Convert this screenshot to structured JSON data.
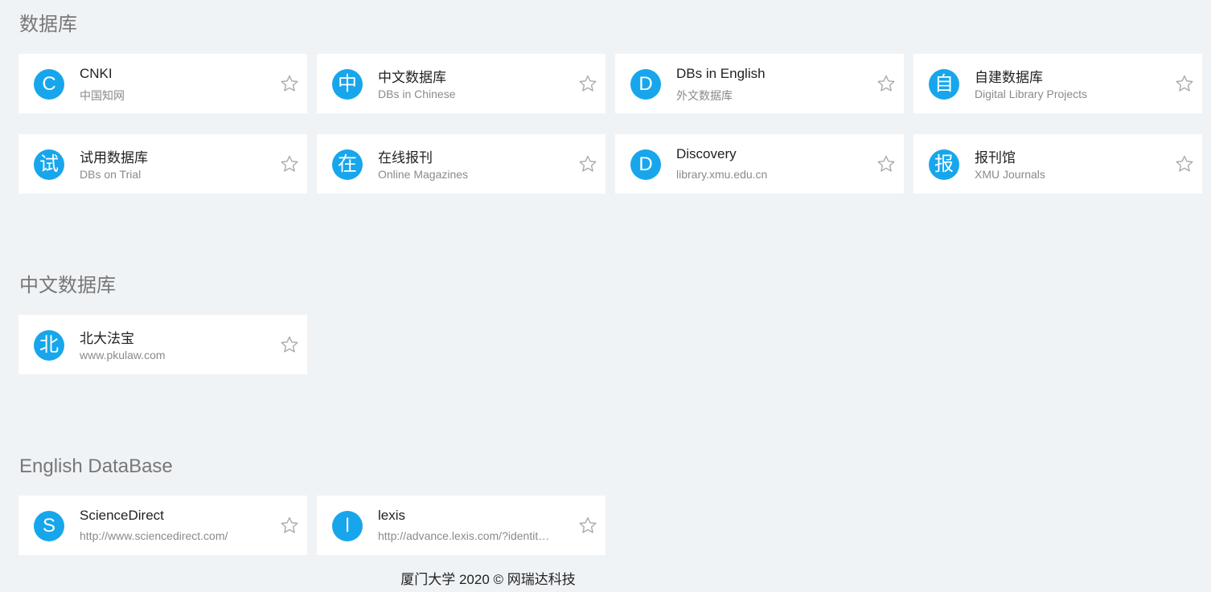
{
  "sections": [
    {
      "title": "数据库",
      "cards": [
        {
          "badge": "C",
          "title": "CNKI",
          "subtitle": "中国知网"
        },
        {
          "badge": "中",
          "title": "中文数据库",
          "subtitle": "DBs in Chinese"
        },
        {
          "badge": "D",
          "title": "DBs in English",
          "subtitle": "外文数据库"
        },
        {
          "badge": "自",
          "title": "自建数据库",
          "subtitle": "Digital Library Projects"
        },
        {
          "badge": "试",
          "title": "试用数据库",
          "subtitle": "DBs on Trial"
        },
        {
          "badge": "在",
          "title": "在线报刊",
          "subtitle": "Online Magazines"
        },
        {
          "badge": "D",
          "title": "Discovery",
          "subtitle": "library.xmu.edu.cn"
        },
        {
          "badge": "报",
          "title": "报刊馆",
          "subtitle": "XMU Journals"
        }
      ]
    },
    {
      "title": "中文数据库",
      "cards": [
        {
          "badge": "北",
          "title": "北大法宝",
          "subtitle": "www.pkulaw.com"
        }
      ]
    },
    {
      "title": "English DataBase",
      "cards": [
        {
          "badge": "S",
          "title": "ScienceDirect",
          "subtitle": "http://www.sciencedirect.com/"
        },
        {
          "badge": "l",
          "title": "lexis",
          "subtitle": "http://advance.lexis.com/?identityprofileid=..."
        }
      ]
    }
  ],
  "footer": "厦门大学 2020 © 网瑞达科技",
  "colors": {
    "background": "#f0f3f6",
    "badge": "#17a6ec",
    "star_outline": "#aaaaaa"
  },
  "icons": {
    "favorite": "star-outline-icon"
  }
}
